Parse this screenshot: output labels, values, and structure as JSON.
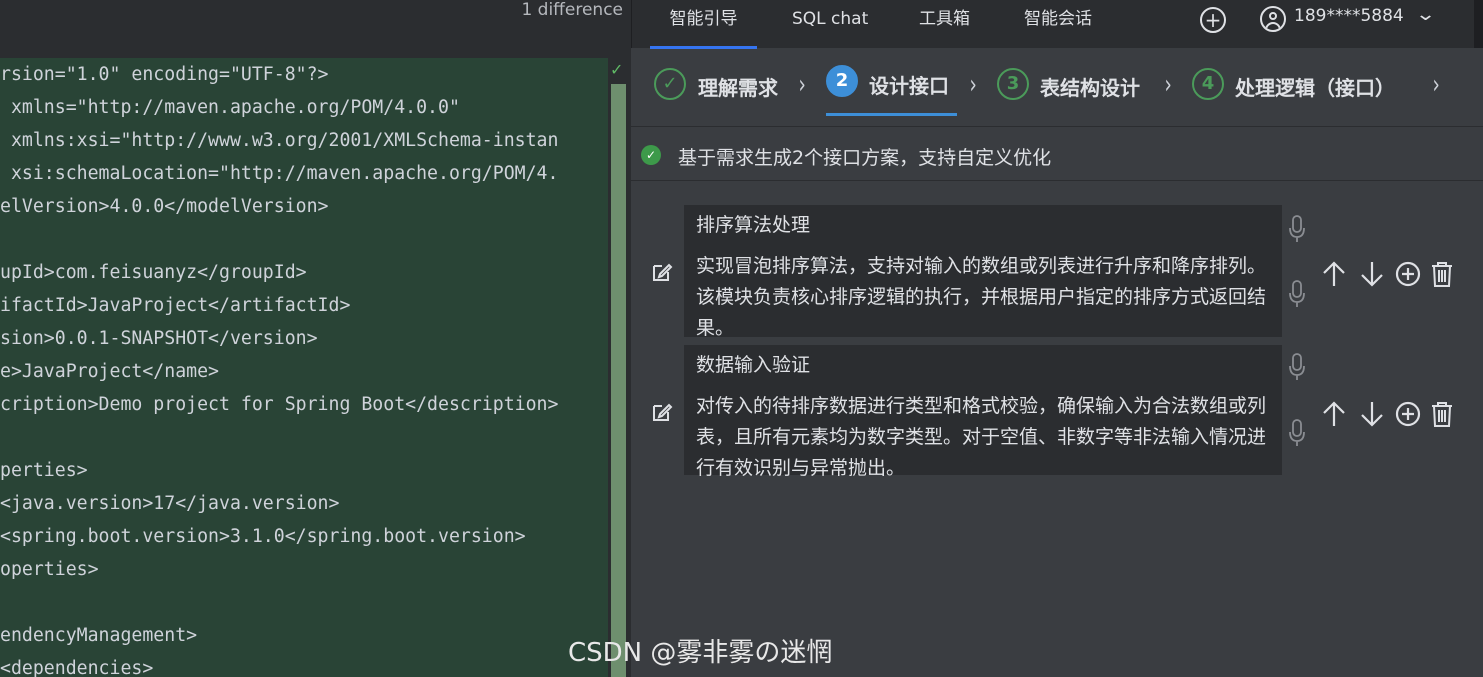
{
  "editor": {
    "diff_count": "1 difference",
    "lines": [
      "rsion=\"1.0\" encoding=\"UTF-8\"?>",
      " xmlns=\"http://maven.apache.org/POM/4.0.0\"",
      " xmlns:xsi=\"http://www.w3.org/2001/XMLSchema-instan",
      " xsi:schemaLocation=\"http://maven.apache.org/POM/4.",
      "elVersion>4.0.0</modelVersion>",
      "",
      "upId>com.feisuanyz</groupId>",
      "ifactId>JavaProject</artifactId>",
      "sion>0.0.1-SNAPSHOT</version>",
      "e>JavaProject</name>",
      "cription>Demo project for Spring Boot</description>",
      "",
      "perties>",
      "<java.version>17</java.version>",
      "<spring.boot.version>3.1.0</spring.boot.version>",
      "operties>",
      "",
      "endencyManagement>",
      "<dependencies>"
    ]
  },
  "nav": {
    "tabs": [
      "智能引导",
      "SQL chat",
      "工具箱",
      "智能会话"
    ],
    "active_tab": "智能引导",
    "add_icon": "plus-circle-icon",
    "user_icon": "user-icon",
    "phone": "189****5884",
    "dropdown_icon": "chevron-down-icon"
  },
  "steps": [
    {
      "label": "理解需求",
      "marker": "✓",
      "state": "done"
    },
    {
      "label": "设计接口",
      "marker": "2",
      "state": "active"
    },
    {
      "label": "表结构设计",
      "marker": "3",
      "state": "pending"
    },
    {
      "label": "处理逻辑（接口）",
      "marker": "4",
      "state": "pending"
    }
  ],
  "status": {
    "icon": "check-circle-icon",
    "text": "基于需求生成2个接口方案，支持自定义优化"
  },
  "cards": [
    {
      "title": "排序算法处理",
      "description": "实现冒泡排序算法，支持对输入的数组或列表进行升序和降序排列。该模块负责核心排序逻辑的执行，并根据用户指定的排序方式返回结果。"
    },
    {
      "title": "数据输入验证",
      "description": "对传入的待排序数据进行类型和格式校验，确保输入为合法数组或列表，且所有元素均为数字类型。对于空值、非数字等非法输入情况进行有效识别与异常抛出。"
    }
  ],
  "card_actions": [
    "arrow-up-icon",
    "arrow-down-icon",
    "plus-circle-icon",
    "trash-icon"
  ],
  "watermark": "CSDN @雾非雾の迷惘",
  "colors": {
    "diff_bg": "#294436",
    "panel_bg": "#3a3d41",
    "card_bg": "#2b2d30",
    "accent": "#3d8fd8",
    "success": "#4b9b5a"
  }
}
